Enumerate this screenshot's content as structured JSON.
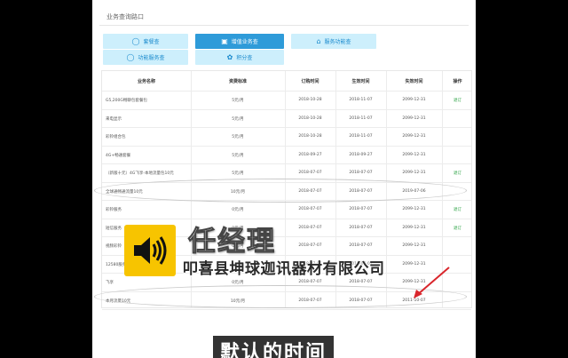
{
  "header": {
    "title": "业务查询路口"
  },
  "tabs": [
    {
      "label": "套餐查",
      "icon": "circle-icon"
    },
    {
      "label": "增值业务查",
      "icon": "briefcase-icon"
    },
    {
      "label": "服务功能查",
      "icon": "home-icon"
    },
    {
      "label": "功能服务查",
      "icon": "circle-icon"
    },
    {
      "label": "积分查",
      "icon": "gift-icon"
    }
  ],
  "table": {
    "headers": [
      "业务名称",
      "资费标准",
      "订购时间",
      "生效时间",
      "失效时间",
      "操作"
    ],
    "rows": [
      [
        "G5,200G畅聊包套餐包",
        "5元/月",
        "2018-10-28",
        "2018-11-07",
        "2099-12-31",
        "退订"
      ],
      [
        "来电显示",
        "5元/月",
        "2018-10-28",
        "2018-11-07",
        "2099-12-31",
        ""
      ],
      [
        "彩铃组合包",
        "5元/月",
        "2018-10-28",
        "2018-11-07",
        "2099-12-31",
        ""
      ],
      [
        "4G+畅通套餐",
        "5元/月",
        "2018-09-27",
        "2018-09-27",
        "2099-12-31",
        ""
      ],
      [
        "（新版十元）4G飞享-本地流量包10元",
        "5元/月",
        "2018-07-07",
        "2018-07-07",
        "2099-12-31",
        "退订"
      ],
      [
        "全球通畅通流量10元",
        "10元/月",
        "2018-07-07",
        "2018-07-07",
        "2019-07-06",
        ""
      ],
      [
        "彩铃服务",
        "0元/月",
        "2018-07-07",
        "2018-07-07",
        "2099-12-31",
        "退订"
      ],
      [
        "短信服务",
        "0元/月",
        "2018-07-07",
        "2018-07-07",
        "2099-12-31",
        "退订"
      ],
      [
        "视频彩铃",
        "0元/月",
        "2018-07-07",
        "2018-07-07",
        "2099-12-31",
        ""
      ],
      [
        "12580服务",
        "0元/月",
        "2018-07-07",
        "2018-07-07",
        "2099-12-31",
        ""
      ],
      [
        "飞享",
        "0元/月",
        "2018-07-07",
        "2018-07-07",
        "2099-12-31",
        ""
      ],
      [
        "本月流量10元",
        "10元/月",
        "2018-07-07",
        "2018-07-07",
        "2011-10-07",
        ""
      ]
    ]
  },
  "overlay": {
    "name": "任经理",
    "company": "叩喜县坤球迦讯器材有限公司",
    "subtitle": "默认的时间",
    "speaker_icon": "speaker-icon"
  },
  "colors": {
    "accent": "#2e9bd9",
    "tab_bg": "#cdeffc",
    "link": "#27a040",
    "speaker_bg": "#f7c400",
    "arrow": "#d9262c"
  }
}
